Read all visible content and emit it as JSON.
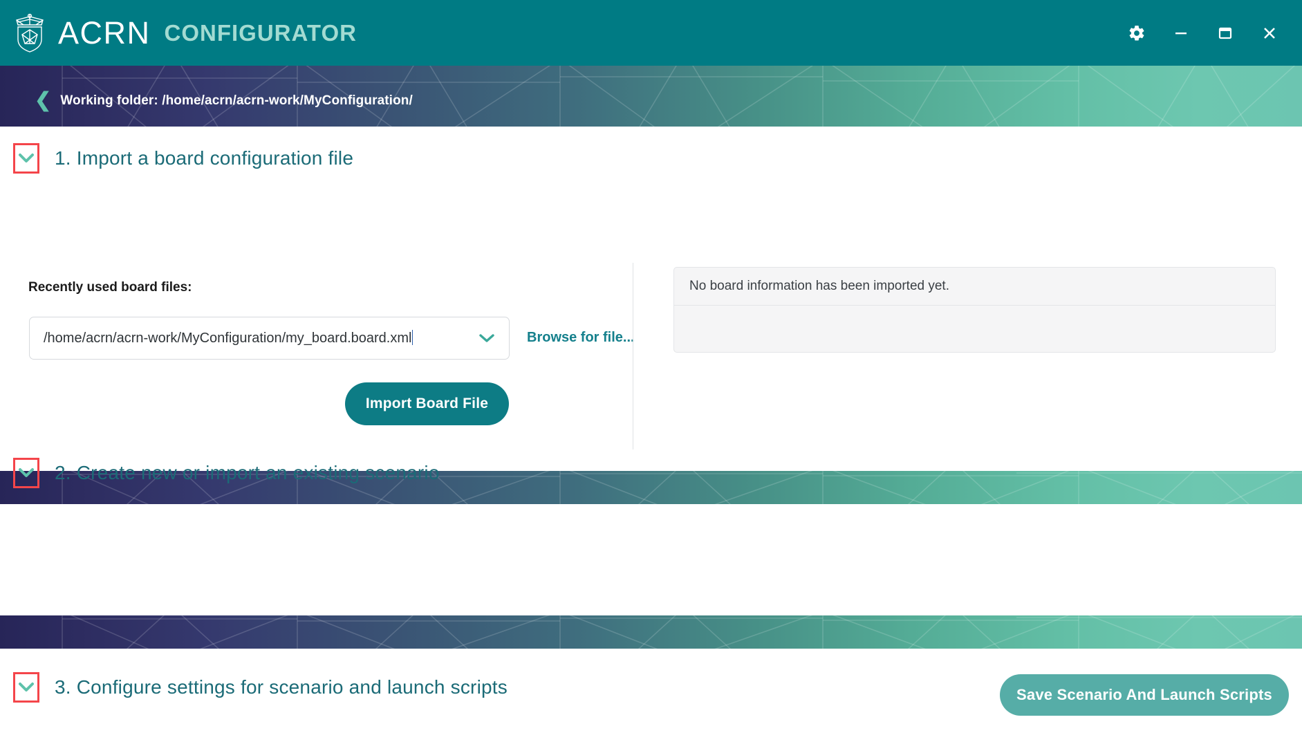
{
  "window": {
    "app_title_primary": "ACRN",
    "app_title_secondary": "CONFIGURATOR",
    "controls": {
      "settings": "gear-icon",
      "minimize": "minimize-icon",
      "maximize": "maximize-icon",
      "close": "close-icon"
    }
  },
  "breadcrumb": {
    "back_glyph": "❮",
    "label": "Working folder: /home/acrn/acrn-work/MyConfiguration/"
  },
  "sections": [
    {
      "id": "import-board",
      "title": "1. Import a board configuration file",
      "expanded_glyph": "chevron-down-icon"
    },
    {
      "id": "create-scenario",
      "title": "2. Create new or import an existing scenario",
      "expanded_glyph": "chevron-down-icon"
    },
    {
      "id": "configure-settings",
      "title": "3. Configure settings for scenario and launch scripts",
      "expanded_glyph": "chevron-down-icon"
    }
  ],
  "board_section": {
    "recent_label": "Recently used board files:",
    "select_value": "/home/acrn/acrn-work/MyConfiguration/my_board.board.xml",
    "select_options": [
      "/home/acrn/acrn-work/MyConfiguration/my_board.board.xml"
    ],
    "browse_label": "Browse for file...",
    "import_button": "Import Board File",
    "board_info_message": "No board information has been imported yet."
  },
  "footer": {
    "save_button": "Save Scenario And Launch Scripts"
  },
  "colors": {
    "titlebar": "#007b84",
    "accent_teal": "#0d7c85",
    "section_title": "#1b6b77",
    "highlight_box": "#f4454a",
    "chevron_green": "#5ec2ab",
    "save_button": "#56ada7",
    "banner_start": "#272558",
    "banner_end": "#6cc5b1"
  }
}
